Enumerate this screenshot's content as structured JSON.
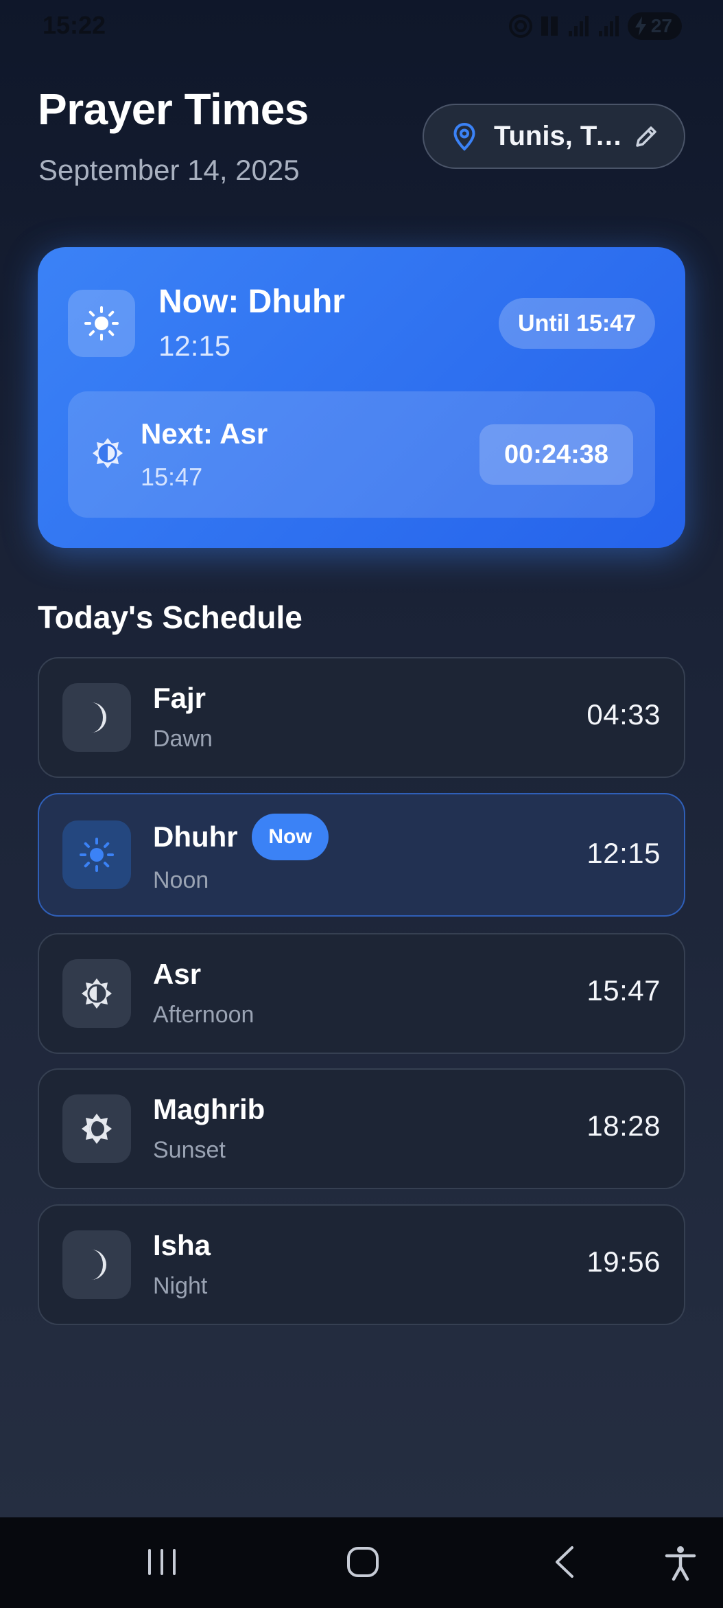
{
  "status_bar": {
    "time": "15:22",
    "battery": "27"
  },
  "header": {
    "title": "Prayer Times",
    "date": "September 14, 2025"
  },
  "location": {
    "text": "Tunis, Tunisia"
  },
  "hero": {
    "current_label": "Now: Dhuhr",
    "current_time": "12:15",
    "until": "Until 15:47",
    "next_label": "Next: Asr",
    "next_time": "15:47",
    "countdown": "00:24:38"
  },
  "schedule": {
    "title": "Today's Schedule",
    "now_badge": "Now",
    "items": [
      {
        "name": "Fajr",
        "subtitle": "Dawn",
        "time": "04:33",
        "icon": "moon-icon",
        "active": false
      },
      {
        "name": "Dhuhr",
        "subtitle": "Noon",
        "time": "12:15",
        "icon": "sun-icon",
        "active": true
      },
      {
        "name": "Asr",
        "subtitle": "Afternoon",
        "time": "15:47",
        "icon": "half-sun-icon",
        "active": false
      },
      {
        "name": "Maghrib",
        "subtitle": "Sunset",
        "time": "18:28",
        "icon": "sunset-icon",
        "active": false
      },
      {
        "name": "Isha",
        "subtitle": "Night",
        "time": "19:56",
        "icon": "moon-icon",
        "active": false
      }
    ]
  },
  "colors": {
    "accent": "#3b82f6",
    "background": "#1a2236",
    "card": "#1d2535"
  }
}
